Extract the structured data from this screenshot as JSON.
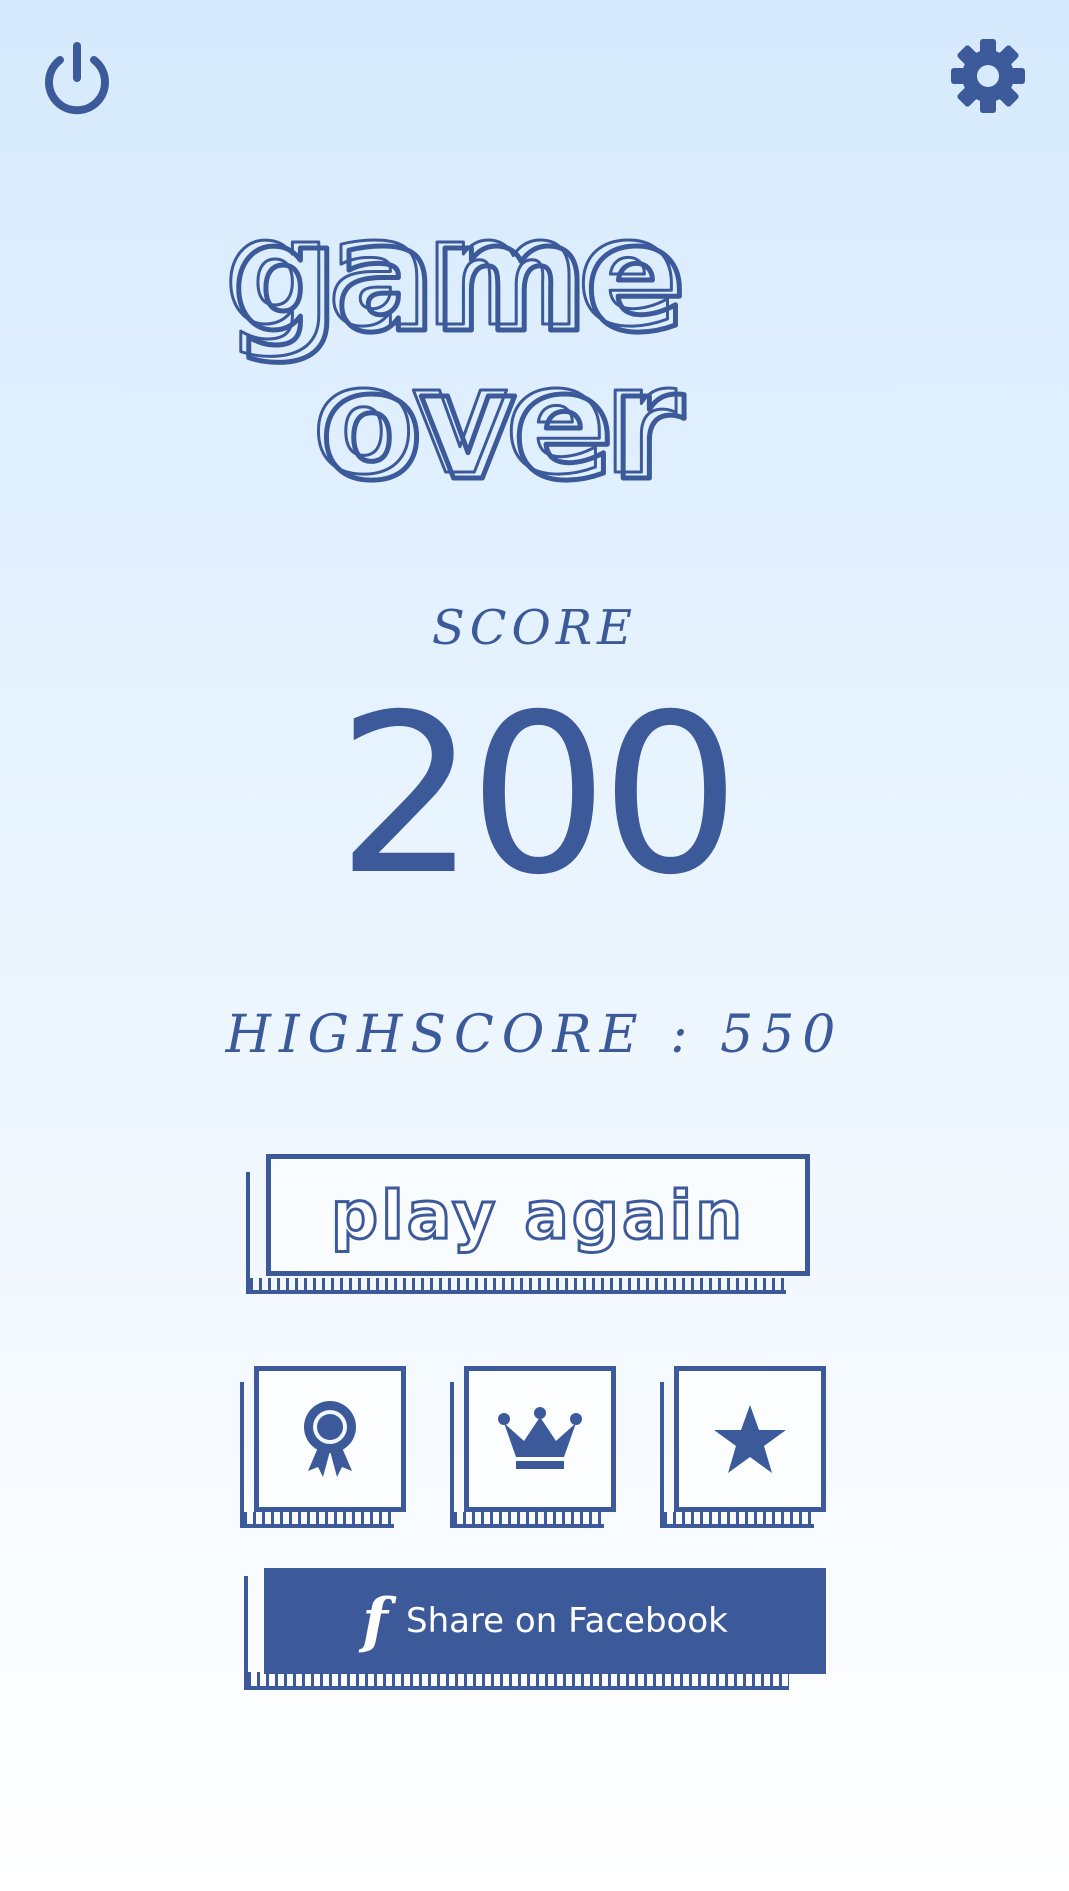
{
  "header": {
    "power_icon": "power-icon",
    "settings_icon": "gear-icon"
  },
  "title": {
    "line1": "game",
    "line2": "over"
  },
  "score": {
    "label": "SCORE",
    "value": "200"
  },
  "highscore": {
    "text": "HIGHSCORE : 550"
  },
  "buttons": {
    "play_again": "play again",
    "achievements_icon": "award-ribbon-icon",
    "leaderboard_icon": "crown-icon",
    "rate_icon": "star-icon",
    "facebook_icon": "f",
    "facebook_label": "Share on Facebook"
  },
  "colors": {
    "ink": "#3c5a9a",
    "background_top": "#d6eafd",
    "background_bottom": "#ffffff"
  }
}
